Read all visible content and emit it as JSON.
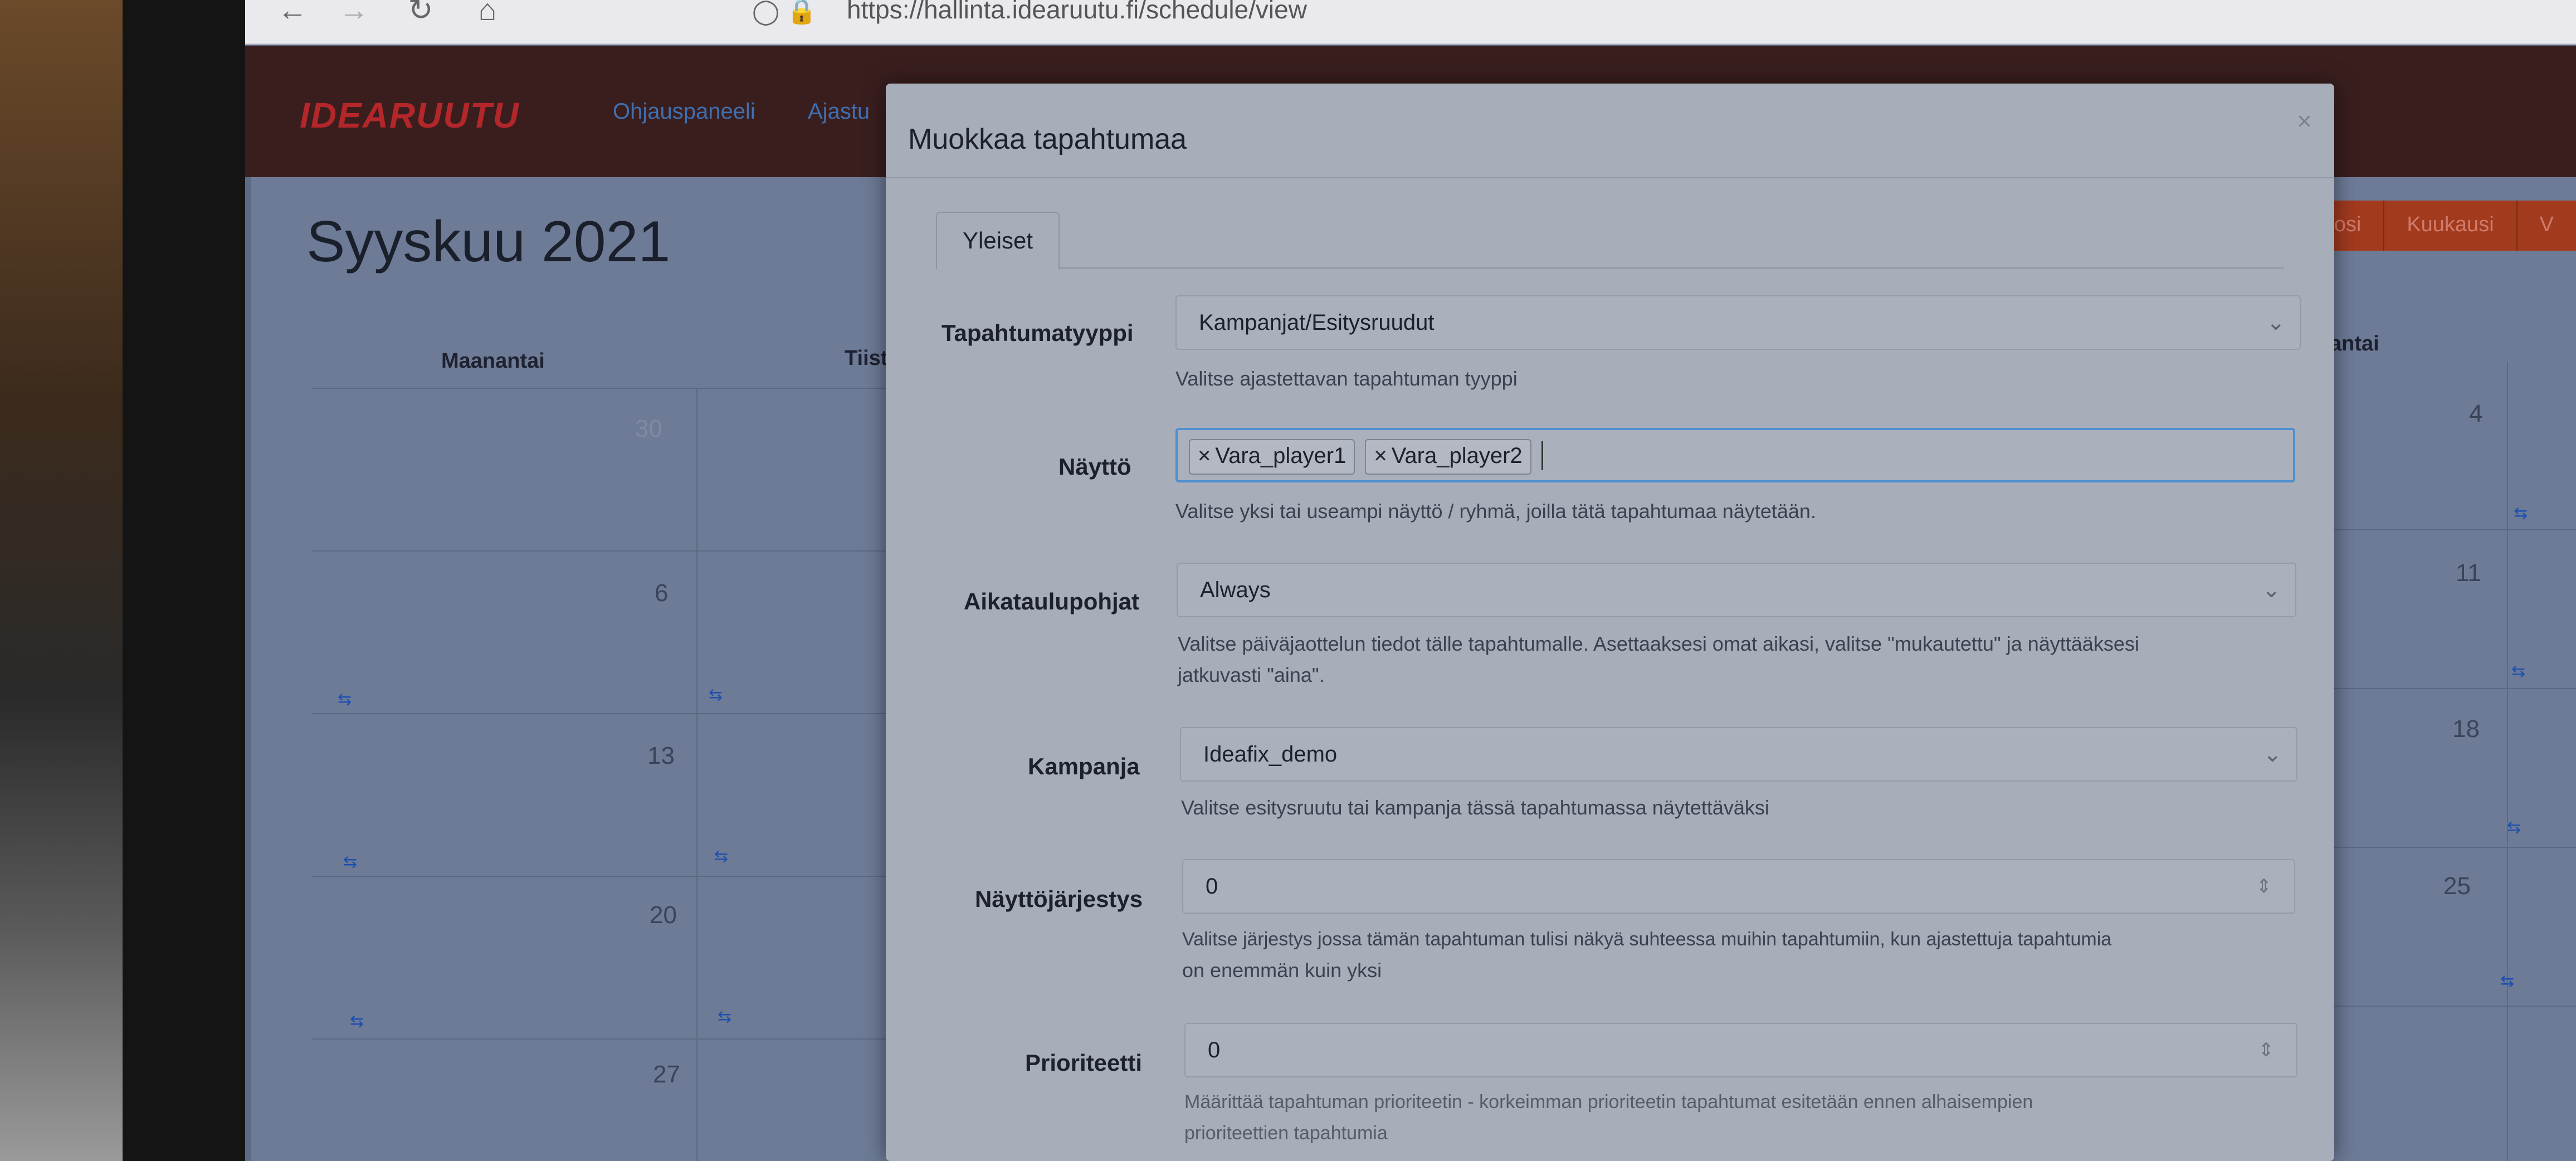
{
  "browser": {
    "url": "https://hallinta.idearuutu.fi/schedule/view",
    "back_icon": "arrow-left",
    "forward_icon": "arrow-right",
    "reload_icon": "reload",
    "home_icon": "home"
  },
  "app": {
    "logo": "IDEARUUTU",
    "nav": [
      "Ohjauspaneeli",
      "Ajastu"
    ],
    "month_title": "Syyskuu 2021",
    "view_buttons": [
      "Vuosi",
      "Kuukausi",
      "V"
    ],
    "day_headers": [
      "Maanantai",
      "Tiist",
      "antai"
    ],
    "dates_left": [
      "30",
      "6",
      "13",
      "20",
      "27"
    ],
    "dates_right": [
      "4",
      "11",
      "18",
      "25"
    ],
    "accent_color": "#b3262a"
  },
  "modal": {
    "title": "Muokkaa tapahtumaa",
    "close_label": "×",
    "tabs": [
      {
        "label": "Yleiset"
      }
    ],
    "fields": {
      "event_type": {
        "label": "Tapahtumatyyppi",
        "value": "Kampanjat/Esitysruudut",
        "help": "Valitse ajastettavan tapahtuman tyyppi"
      },
      "display": {
        "label": "Näyttö",
        "tags": [
          "Vara_player1",
          "Vara_player2"
        ],
        "tag_remove": "×",
        "help": "Valitse yksi tai useampi näyttö / ryhmä, joilla tätä tapahtumaa näytetään."
      },
      "schedule_templates": {
        "label": "Aikataulupohjat",
        "value": "Always",
        "help_line1": "Valitse päiväjaottelun tiedot tälle tapahtumalle. Asettaaksesi omat aikasi, valitse \"mukautettu\" ja näyttääksesi",
        "help_line2": "jatkuvasti \"aina\"."
      },
      "campaign": {
        "label": "Kampanja",
        "value": "Ideafix_demo",
        "help": "Valitse esitysruutu tai kampanja tässä tapahtumassa näytettäväksi"
      },
      "display_order": {
        "label": "Näyttöjärjestys",
        "value": "0",
        "help_line1": "Valitse järjestys jossa tämän tapahtuman tulisi näkyä suhteessa muihin tapahtumiin, kun ajastettuja tapahtumia",
        "help_line2": "on enemmän kuin yksi"
      },
      "priority": {
        "label": "Prioriteetti",
        "value": "0",
        "help_line1": "Määrittää tapahtuman prioriteetin - korkeimman prioriteetin tapahtumat esitetään ennen alhaisempien",
        "help_line2": "prioriteettien tapahtumia"
      }
    }
  }
}
